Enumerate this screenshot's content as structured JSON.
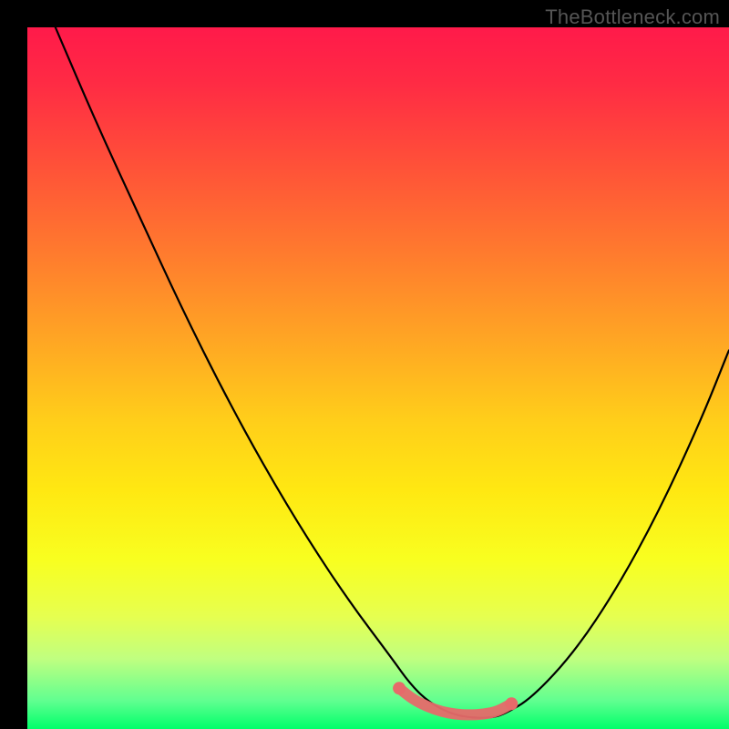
{
  "watermark": "TheBottleneck.com",
  "chart_data": {
    "type": "line",
    "title": "",
    "xlabel": "",
    "ylabel": "",
    "xlim": [
      0,
      100
    ],
    "ylim": [
      0,
      100
    ],
    "background_gradient": {
      "top": "#ff1a4a",
      "bottom": "#00ff6a",
      "description": "vertical red-to-green heat gradient"
    },
    "series": [
      {
        "name": "bottleneck-curve",
        "color": "#000000",
        "x": [
          4,
          10,
          16,
          22,
          28,
          34,
          40,
          46,
          52,
          54.5,
          57,
          60,
          63,
          66,
          68,
          72,
          78,
          84,
          90,
          96,
          100
        ],
        "values": [
          100,
          86,
          73,
          60,
          48,
          37,
          27,
          18,
          10,
          6.5,
          4,
          2.3,
          1.6,
          1.6,
          2.1,
          4.5,
          11,
          20,
          31,
          44,
          54
        ]
      },
      {
        "name": "optimum-band",
        "color": "#e66a6a",
        "render": "thick-dotted-flat-segment",
        "x": [
          53,
          55,
          57,
          59,
          61,
          63,
          65,
          67,
          69
        ],
        "values": [
          5.8,
          4.2,
          3.2,
          2.5,
          2.1,
          2.0,
          2.1,
          2.5,
          3.6
        ]
      }
    ]
  }
}
